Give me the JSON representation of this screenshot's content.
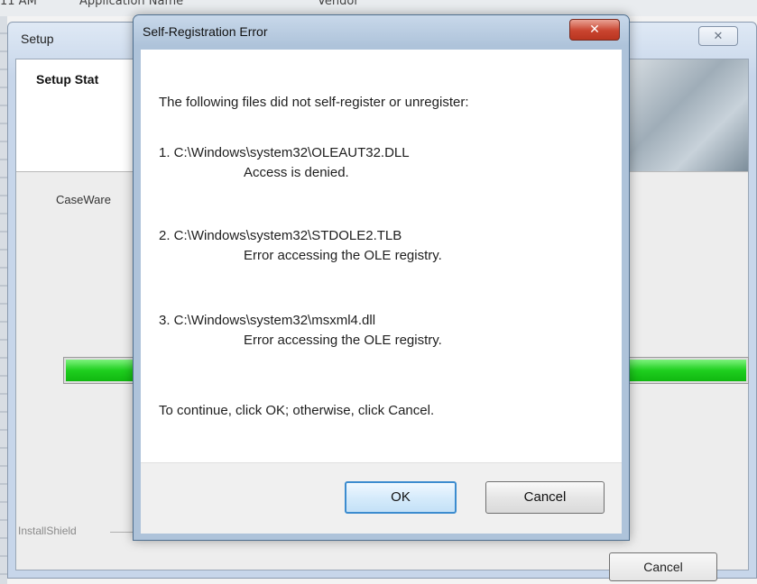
{
  "background_app": {
    "strip_texts": [
      "11 AM",
      "Application Name",
      "Vendor"
    ]
  },
  "setup_window": {
    "title": "Setup",
    "close_glyph": "✕",
    "header_title": "Setup Stat",
    "status_text": "CaseWare",
    "progress": 1.0,
    "installshield_label": "InstallShield",
    "cancel_label": "Cancel"
  },
  "dialog": {
    "title": "Self-Registration Error",
    "close_glyph": "✕",
    "intro": "The following files did not self-register or unregister:",
    "errors": [
      {
        "file": "1. C:\\Windows\\system32\\OLEAUT32.DLL",
        "message": "Access is denied."
      },
      {
        "file": "2. C:\\Windows\\system32\\STDOLE2.TLB",
        "message": "Error accessing the OLE registry."
      },
      {
        "file": "3. C:\\Windows\\system32\\msxml4.dll",
        "message": "Error accessing the OLE registry."
      }
    ],
    "instruction": "To continue, click OK; otherwise, click Cancel.",
    "ok_label": "OK",
    "cancel_label": "Cancel"
  },
  "colors": {
    "progress_green": "#1fcf1f",
    "close_red": "#c9442f",
    "ok_focus_border": "#3c8ccf"
  }
}
